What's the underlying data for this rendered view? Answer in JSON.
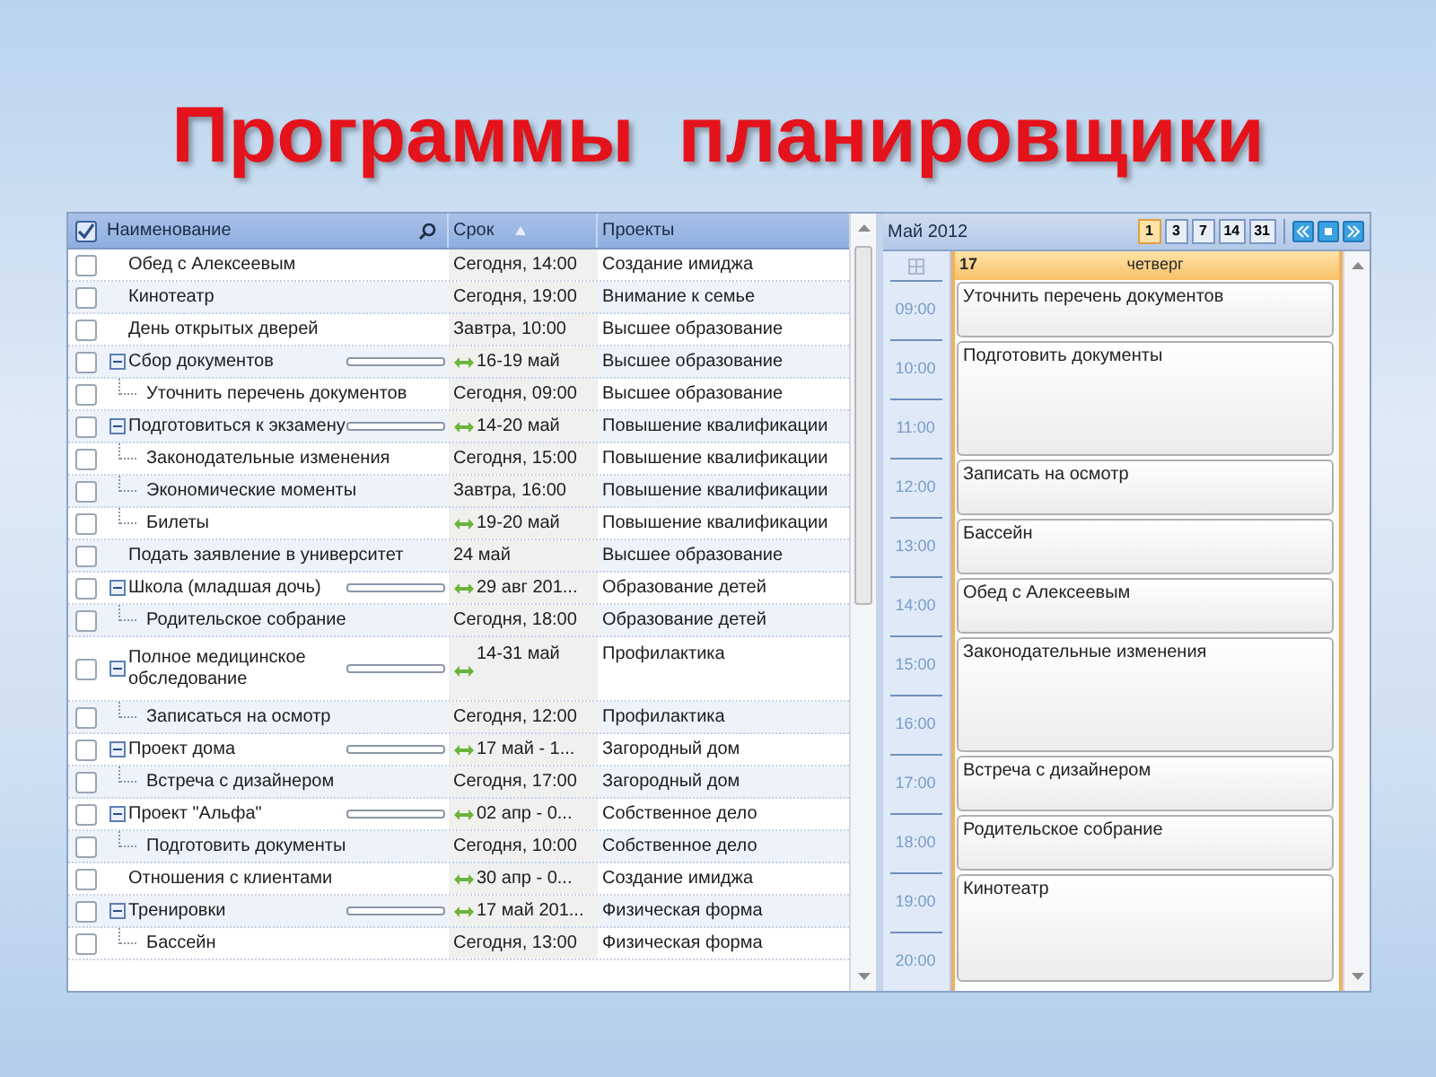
{
  "title": "Программы  планировщики",
  "table": {
    "select_all": {
      "checked": true
    },
    "columns": [
      {
        "label": "Наименование"
      },
      {
        "label": "Срок"
      },
      {
        "label": "Проекты"
      }
    ],
    "rows": [
      {
        "name": "Обед с Алексеевым",
        "due": "Сегодня, 14:00",
        "project": "Создание имиджа",
        "checked": false,
        "span": false
      },
      {
        "name": "Кинотеатр",
        "due": "Сегодня, 19:00",
        "project": "Внимание к семье",
        "checked": false,
        "span": false
      },
      {
        "name": "День открытых дверей",
        "due": "Завтра, 10:00",
        "project": "Высшее образование",
        "checked": false,
        "span": false
      },
      {
        "name": "Сбор документов",
        "due": "16-19 май",
        "project": "Высшее образование",
        "checked": false,
        "span": true,
        "expanded": true,
        "children": [
          {
            "name": "Уточнить перечень документов",
            "due": "Сегодня, 09:00",
            "project": "Высшее образование",
            "checked": false,
            "span": false
          }
        ]
      },
      {
        "name": "Подготовиться к экзамену",
        "due": "14-20 май",
        "project": "Повышение квалификации",
        "checked": false,
        "span": true,
        "expanded": true,
        "children": [
          {
            "name": "Законодательные изменения",
            "due": "Сегодня, 15:00",
            "project": "Повышение квалификации",
            "checked": false,
            "span": false
          },
          {
            "name": "Экономические моменты",
            "due": "Завтра, 16:00",
            "project": "Повышение квалификации",
            "checked": false,
            "span": false
          },
          {
            "name": "Билеты",
            "due": "19-20 май",
            "project": "Повышение квалификации",
            "checked": false,
            "span": true
          }
        ]
      },
      {
        "name": "Подать заявление в университет",
        "due": "24 май",
        "project": "Высшее образование",
        "checked": false,
        "span": false
      },
      {
        "name": "Школа (младшая дочь)",
        "due": "29 авг 201...",
        "project": "Образование детей",
        "checked": false,
        "span": true,
        "expanded": true,
        "children": [
          {
            "name": "Родительское собрание",
            "due": "Сегодня, 18:00",
            "project": "Образование детей",
            "checked": false,
            "span": false
          }
        ]
      },
      {
        "name": "Полное медицинское обследование",
        "due": "14-31 май",
        "project": "Профилактика",
        "checked": false,
        "span": true,
        "expanded": true,
        "children": [
          {
            "name": "Записаться  на осмотр",
            "due": "Сегодня, 12:00",
            "project": "Профилактика",
            "checked": false,
            "span": false
          }
        ]
      },
      {
        "name": "Проект дома",
        "due": "17 май - 1...",
        "project": "Загородный дом",
        "checked": false,
        "span": true,
        "expanded": true,
        "children": [
          {
            "name": "Встреча с дизайнером",
            "due": "Сегодня, 17:00",
            "project": "Загородный дом",
            "checked": false,
            "span": false
          }
        ]
      },
      {
        "name": "Проект \"Альфа\"",
        "due": "02 апр - 0...",
        "project": "Собственное дело",
        "checked": false,
        "span": true,
        "expanded": true,
        "children": [
          {
            "name": "Подготовить документы",
            "due": "Сегодня, 10:00",
            "project": "Собственное дело",
            "checked": false,
            "span": false
          }
        ]
      },
      {
        "name": "Отношения с клиентами",
        "due": "30 апр - 0...",
        "project": "Создание имиджа",
        "checked": false,
        "span": true
      },
      {
        "name": "Тренировки",
        "due": "17 май 201...",
        "project": "Физическая форма",
        "checked": false,
        "span": true,
        "expanded": true,
        "children": [
          {
            "name": "Бассейн",
            "due": "Сегодня, 13:00",
            "project": "Физическая форма",
            "checked": false,
            "span": false
          }
        ]
      }
    ]
  },
  "calendar": {
    "month": "Май 2012",
    "views": [
      {
        "label": "1",
        "selected": true
      },
      {
        "label": "3",
        "selected": false
      },
      {
        "label": "7",
        "selected": false
      },
      {
        "label": "14",
        "selected": false
      },
      {
        "label": "31",
        "selected": false
      }
    ],
    "day": {
      "number": "17",
      "weekday": "четверг"
    },
    "hours": [
      "09:00",
      "10:00",
      "11:00",
      "12:00",
      "13:00",
      "14:00",
      "15:00",
      "16:00",
      "17:00",
      "18:00",
      "19:00",
      "20:00"
    ],
    "events": [
      {
        "title": "Уточнить перечень документов",
        "kind": "short"
      },
      {
        "title": "Подготовить документы",
        "kind": "long"
      },
      {
        "title": "Записать на осмотр",
        "kind": "short"
      },
      {
        "title": "Бассейн",
        "kind": "short"
      },
      {
        "title": "Обед с Алексеевым",
        "kind": "short"
      },
      {
        "title": "Законодательные изменения",
        "kind": "long"
      },
      {
        "title": "Встреча с дизайнером",
        "kind": "short"
      },
      {
        "title": "Родительское собрание",
        "kind": "short"
      },
      {
        "title": "Кинотеатр",
        "kind": "long"
      }
    ]
  }
}
